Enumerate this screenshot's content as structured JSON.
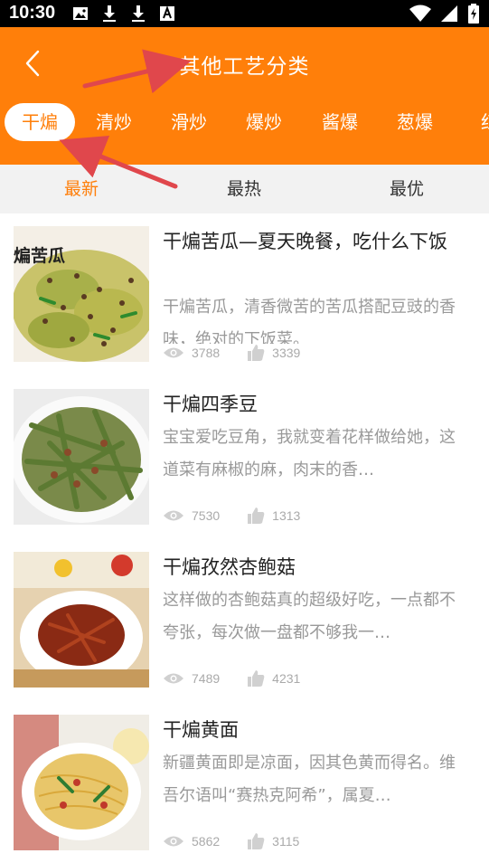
{
  "status_bar": {
    "time": "10:30"
  },
  "header": {
    "title": "其他工艺分类"
  },
  "categories": [
    {
      "label": "干煸",
      "active": true
    },
    {
      "label": "清炒",
      "active": false
    },
    {
      "label": "滑炒",
      "active": false
    },
    {
      "label": "爆炒",
      "active": false
    },
    {
      "label": "酱爆",
      "active": false
    },
    {
      "label": "葱爆",
      "active": false
    },
    {
      "label": "红",
      "active": false
    }
  ],
  "sort_tabs": [
    {
      "label": "最新",
      "active": true
    },
    {
      "label": "最热",
      "active": false
    },
    {
      "label": "最优",
      "active": false
    }
  ],
  "recipes": [
    {
      "title": "干煸苦瓜—夏天晚餐，吃什么下饭",
      "description": "干煸苦瓜，清香微苦的苦瓜搭配豆豉的香味，绝对的下饭菜。",
      "views": "3788",
      "likes": "3339",
      "image_label": "煸苦瓜"
    },
    {
      "title": "干煸四季豆",
      "description": "宝宝爱吃豆角，我就变着花样做给她，这道菜有麻椒的麻，肉末的香…",
      "views": "7530",
      "likes": "1313"
    },
    {
      "title": "干煸孜然杏鲍菇",
      "description": "这样做的杏鲍菇真的超级好吃，一点都不夸张，每次做一盘都不够我一…",
      "views": "7489",
      "likes": "4231"
    },
    {
      "title": "干煸黄面",
      "description": "新疆黄面即是凉面，因其色黄而得名。维吾尔语叫“赛热克阿希”，属夏…",
      "views": "5862",
      "likes": "3115"
    }
  ],
  "colors": {
    "accent": "#ff7f0a",
    "annotation_arrow": "#e0474c"
  },
  "icons": [
    "back-chevron-icon",
    "eye-icon",
    "thumbs-up-icon",
    "wifi-icon",
    "signal-icon",
    "battery-icon",
    "image-icon",
    "download-icon",
    "font-icon"
  ]
}
